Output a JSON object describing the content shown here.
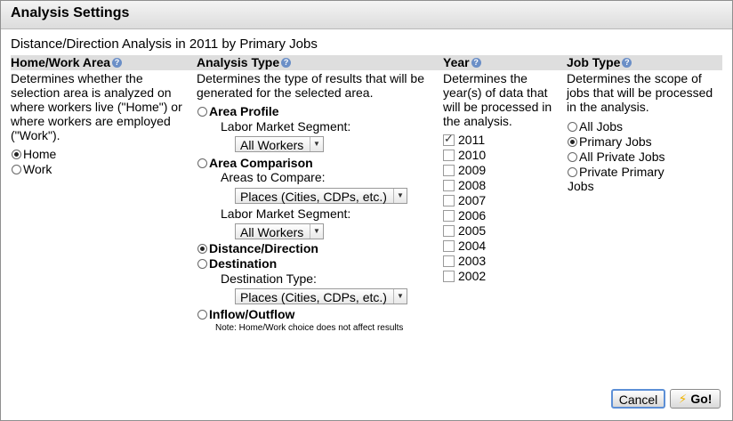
{
  "dialog_title": "Analysis Settings",
  "heading": "Distance/Direction Analysis in 2011 by Primary Jobs",
  "help_glyph": "?",
  "home_work": {
    "title": "Home/Work Area",
    "description": "Determines whether the selection area is analyzed on where workers live (\"Home\") or where workers are employed (\"Work\").",
    "options": [
      {
        "label": "Home",
        "selected": true
      },
      {
        "label": "Work",
        "selected": false
      }
    ]
  },
  "analysis_type": {
    "title": "Analysis Type",
    "description": "Determines the type of results that will be generated for the selected area.",
    "area_profile": {
      "label": "Area Profile",
      "selected": false,
      "segment_label": "Labor Market Segment:",
      "segment_value": "All Workers"
    },
    "area_comparison": {
      "label": "Area Comparison",
      "selected": false,
      "compare_label": "Areas to Compare:",
      "compare_value": "Places (Cities, CDPs, etc.)",
      "segment_label": "Labor Market Segment:",
      "segment_value": "All Workers"
    },
    "distance_direction": {
      "label": "Distance/Direction",
      "selected": true
    },
    "destination": {
      "label": "Destination",
      "selected": false,
      "type_label": "Destination Type:",
      "type_value": "Places (Cities, CDPs, etc.)"
    },
    "inflow_outflow": {
      "label": "Inflow/Outflow",
      "selected": false,
      "note": "Note: Home/Work choice does not affect results"
    }
  },
  "year": {
    "title": "Year",
    "description": "Determines the year(s) of data that will be processed in the analysis.",
    "years": [
      {
        "label": "2011",
        "checked": true
      },
      {
        "label": "2010",
        "checked": false
      },
      {
        "label": "2009",
        "checked": false
      },
      {
        "label": "2008",
        "checked": false
      },
      {
        "label": "2007",
        "checked": false
      },
      {
        "label": "2006",
        "checked": false
      },
      {
        "label": "2005",
        "checked": false
      },
      {
        "label": "2004",
        "checked": false
      },
      {
        "label": "2003",
        "checked": false
      },
      {
        "label": "2002",
        "checked": false
      }
    ]
  },
  "job_type": {
    "title": "Job Type",
    "description": "Determines the scope of jobs that will be processed in the analysis.",
    "options": [
      {
        "label": "All Jobs",
        "selected": false
      },
      {
        "label": "Primary Jobs",
        "selected": true
      },
      {
        "label": "All Private Jobs",
        "selected": false
      },
      {
        "label": "Private Primary Jobs",
        "selected": false
      }
    ]
  },
  "buttons": {
    "cancel": "Cancel",
    "go": "Go!"
  },
  "colors": {
    "header_band": "#dedede",
    "help_icon": "#6b8fc7",
    "go_bolt": "#f0b400",
    "cancel_focus": "#5c8fd6"
  }
}
